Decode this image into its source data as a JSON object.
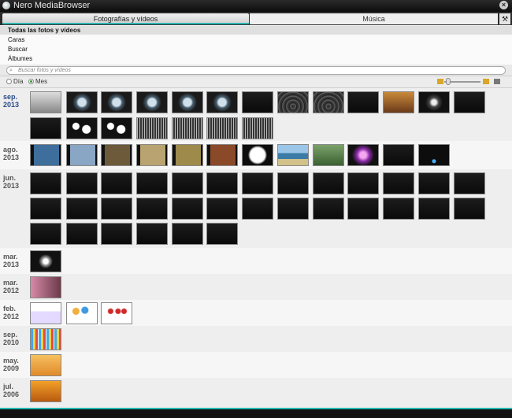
{
  "window": {
    "title": "Nero MediaBrowser"
  },
  "tabs": [
    {
      "label": "Fotografías y vídeos"
    },
    {
      "label": "Música"
    }
  ],
  "nav": {
    "items": [
      "Todas las fotos y vídeos",
      "Caras",
      "Buscar",
      "Álbumes"
    ]
  },
  "search": {
    "placeholder": "Buscar fotos y vídeos"
  },
  "view": {
    "day_label": "Día",
    "month_label": "Mes",
    "selected": "Mes"
  },
  "groups": [
    {
      "label": "sep.\n2013",
      "active": true
    },
    {
      "label": "ago.\n2013"
    },
    {
      "label": "jun.\n2013"
    },
    {
      "label": "mar.\n2013"
    },
    {
      "label": "mar.\n2012"
    },
    {
      "label": "feb.\n2012"
    },
    {
      "label": "sep.\n2010"
    },
    {
      "label": "may.\n2009"
    },
    {
      "label": "jul.\n2006"
    }
  ]
}
